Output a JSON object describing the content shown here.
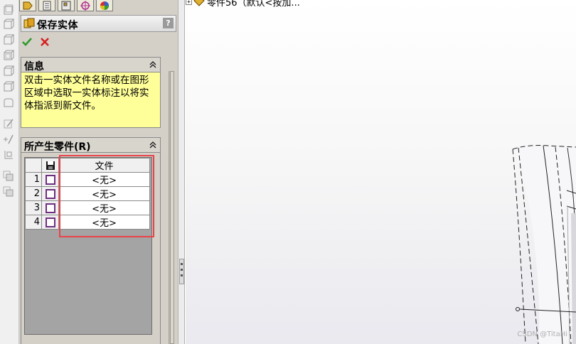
{
  "panel": {
    "title": "保存实体",
    "help": "?",
    "info_group": {
      "title": "信息",
      "text": "双击一实体文件名称或在图形区域中选取一实体标注以将实体指派到新文件。"
    },
    "parts_group": {
      "title": "所产生零件(R)",
      "column_file": "文件",
      "rows": [
        {
          "index": "1",
          "file": "<无>"
        },
        {
          "index": "2",
          "file": "<无>"
        },
        {
          "index": "3",
          "file": "<无>"
        },
        {
          "index": "4",
          "file": "<无>"
        }
      ]
    }
  },
  "tree": {
    "node_label": "零件56（默认<按加..."
  },
  "watermark": "CSDN @TitaHi",
  "colors": {
    "info_background": "#ffff99",
    "highlight_border": "#e8424a",
    "ok_green": "#2a9a2a",
    "cancel_red": "#d42020"
  }
}
